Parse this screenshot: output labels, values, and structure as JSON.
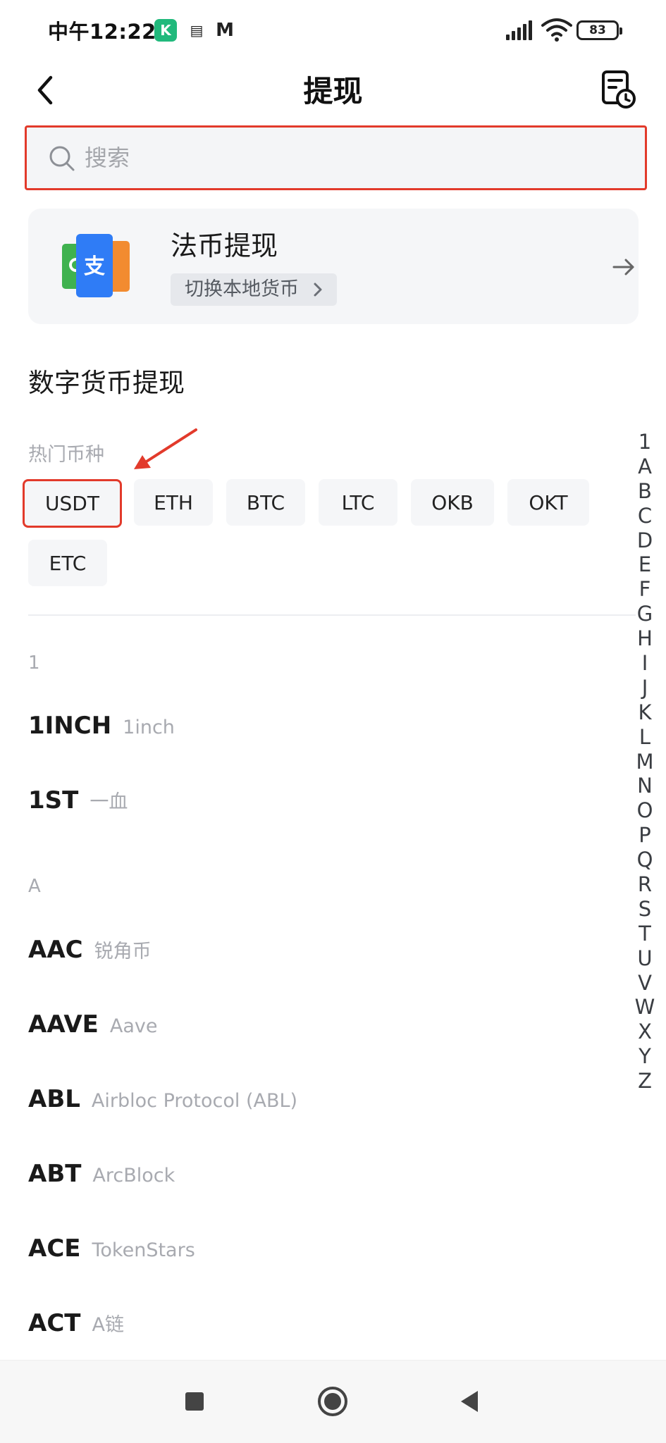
{
  "status_bar": {
    "time": "中午12:22",
    "battery": "83",
    "app_icons": [
      "kucoin-icon",
      "doc-icon",
      "mail-icon"
    ]
  },
  "header": {
    "title": "提现",
    "back_icon": "chevron-left-icon",
    "history_icon": "history-icon"
  },
  "search": {
    "placeholder": "搜索"
  },
  "fiat_card": {
    "title": "法币提现",
    "chip_label": "切换本地货币"
  },
  "section": {
    "heading": "数字货币提现",
    "hot_label": "热门币种"
  },
  "hot_coins": [
    "USDT",
    "ETH",
    "BTC",
    "LTC",
    "OKB",
    "OKT",
    "ETC"
  ],
  "highlighted_coin": "USDT",
  "groups": [
    {
      "letter": "1",
      "items": [
        {
          "symbol": "1INCH",
          "name": "1inch"
        },
        {
          "symbol": "1ST",
          "name": "一血"
        }
      ]
    },
    {
      "letter": "A",
      "items": [
        {
          "symbol": "AAC",
          "name": "锐角币"
        },
        {
          "symbol": "AAVE",
          "name": "Aave"
        },
        {
          "symbol": "ABL",
          "name": "Airbloc Protocol (ABL)"
        },
        {
          "symbol": "ABT",
          "name": "ArcBlock"
        },
        {
          "symbol": "ACE",
          "name": "TokenStars"
        },
        {
          "symbol": "ACT",
          "name": "A链"
        }
      ]
    }
  ],
  "index_letters": [
    "1",
    "A",
    "B",
    "C",
    "D",
    "E",
    "F",
    "G",
    "H",
    "I",
    "J",
    "K",
    "L",
    "M",
    "N",
    "O",
    "P",
    "Q",
    "R",
    "S",
    "T",
    "U",
    "V",
    "W",
    "X",
    "Y",
    "Z"
  ],
  "colors": {
    "highlight": "#e23a2b",
    "card_bg": "#f5f6f8",
    "muted_text": "#a8aab0"
  }
}
